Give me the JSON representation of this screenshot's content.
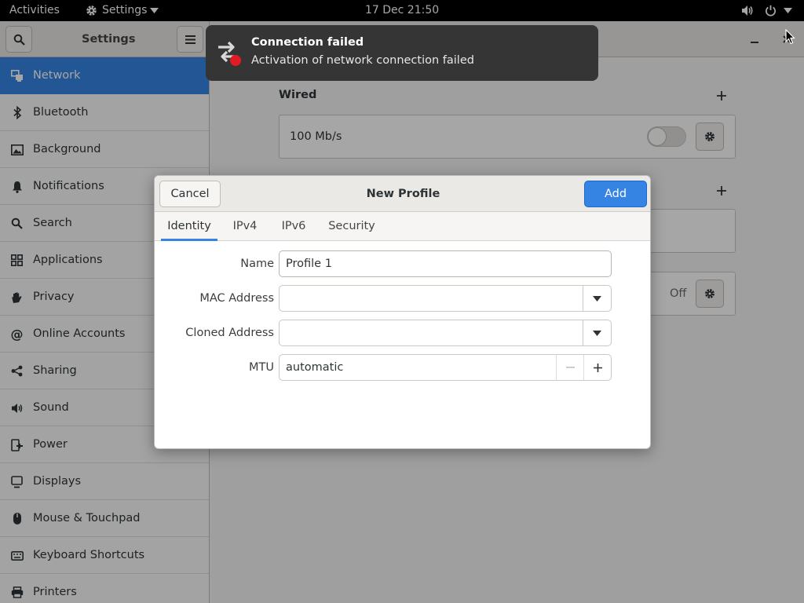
{
  "topbar": {
    "activities": "Activities",
    "app_menu": "Settings",
    "clock": "17 Dec  21:50"
  },
  "window": {
    "sidebar_title": "Settings",
    "sidebar": {
      "selected": "Network",
      "items": [
        {
          "label": "Network",
          "icon": "network-icon"
        },
        {
          "label": "Bluetooth",
          "icon": "bluetooth-icon"
        },
        {
          "label": "Background",
          "icon": "background-icon"
        },
        {
          "label": "Notifications",
          "icon": "bell-icon"
        },
        {
          "label": "Search",
          "icon": "search-icon"
        },
        {
          "label": "Applications",
          "icon": "apps-grid-icon"
        },
        {
          "label": "Privacy",
          "icon": "hand-icon"
        },
        {
          "label": "Online Accounts",
          "icon": "at-icon"
        },
        {
          "label": "Sharing",
          "icon": "share-icon"
        },
        {
          "label": "Sound",
          "icon": "speaker-icon"
        },
        {
          "label": "Power",
          "icon": "power-plug-icon"
        },
        {
          "label": "Displays",
          "icon": "display-icon"
        },
        {
          "label": "Mouse & Touchpad",
          "icon": "mouse-icon"
        },
        {
          "label": "Keyboard Shortcuts",
          "icon": "keyboard-icon"
        },
        {
          "label": "Printers",
          "icon": "printer-icon"
        }
      ]
    },
    "wired": {
      "heading": "Wired",
      "connection_speed": "100 Mb/s",
      "toggle_on": false
    },
    "proxy": {
      "status": "Off"
    }
  },
  "notification": {
    "title": "Connection failed",
    "body": "Activation of network connection failed"
  },
  "dialog": {
    "title": "New Profile",
    "cancel_label": "Cancel",
    "add_label": "Add",
    "tabs": [
      "Identity",
      "IPv4",
      "IPv6",
      "Security"
    ],
    "active_tab": "Identity",
    "fields": {
      "name_label": "Name",
      "name_value": "Profile 1",
      "mac_label": "MAC Address",
      "mac_value": "",
      "cloned_label": "Cloned Address",
      "cloned_value": "",
      "mtu_label": "MTU",
      "mtu_value": "automatic"
    }
  },
  "colors": {
    "accent": "#3584e4",
    "topbar": "#000000",
    "notification_bg": "#353535",
    "error_badge": "#e01b24"
  }
}
